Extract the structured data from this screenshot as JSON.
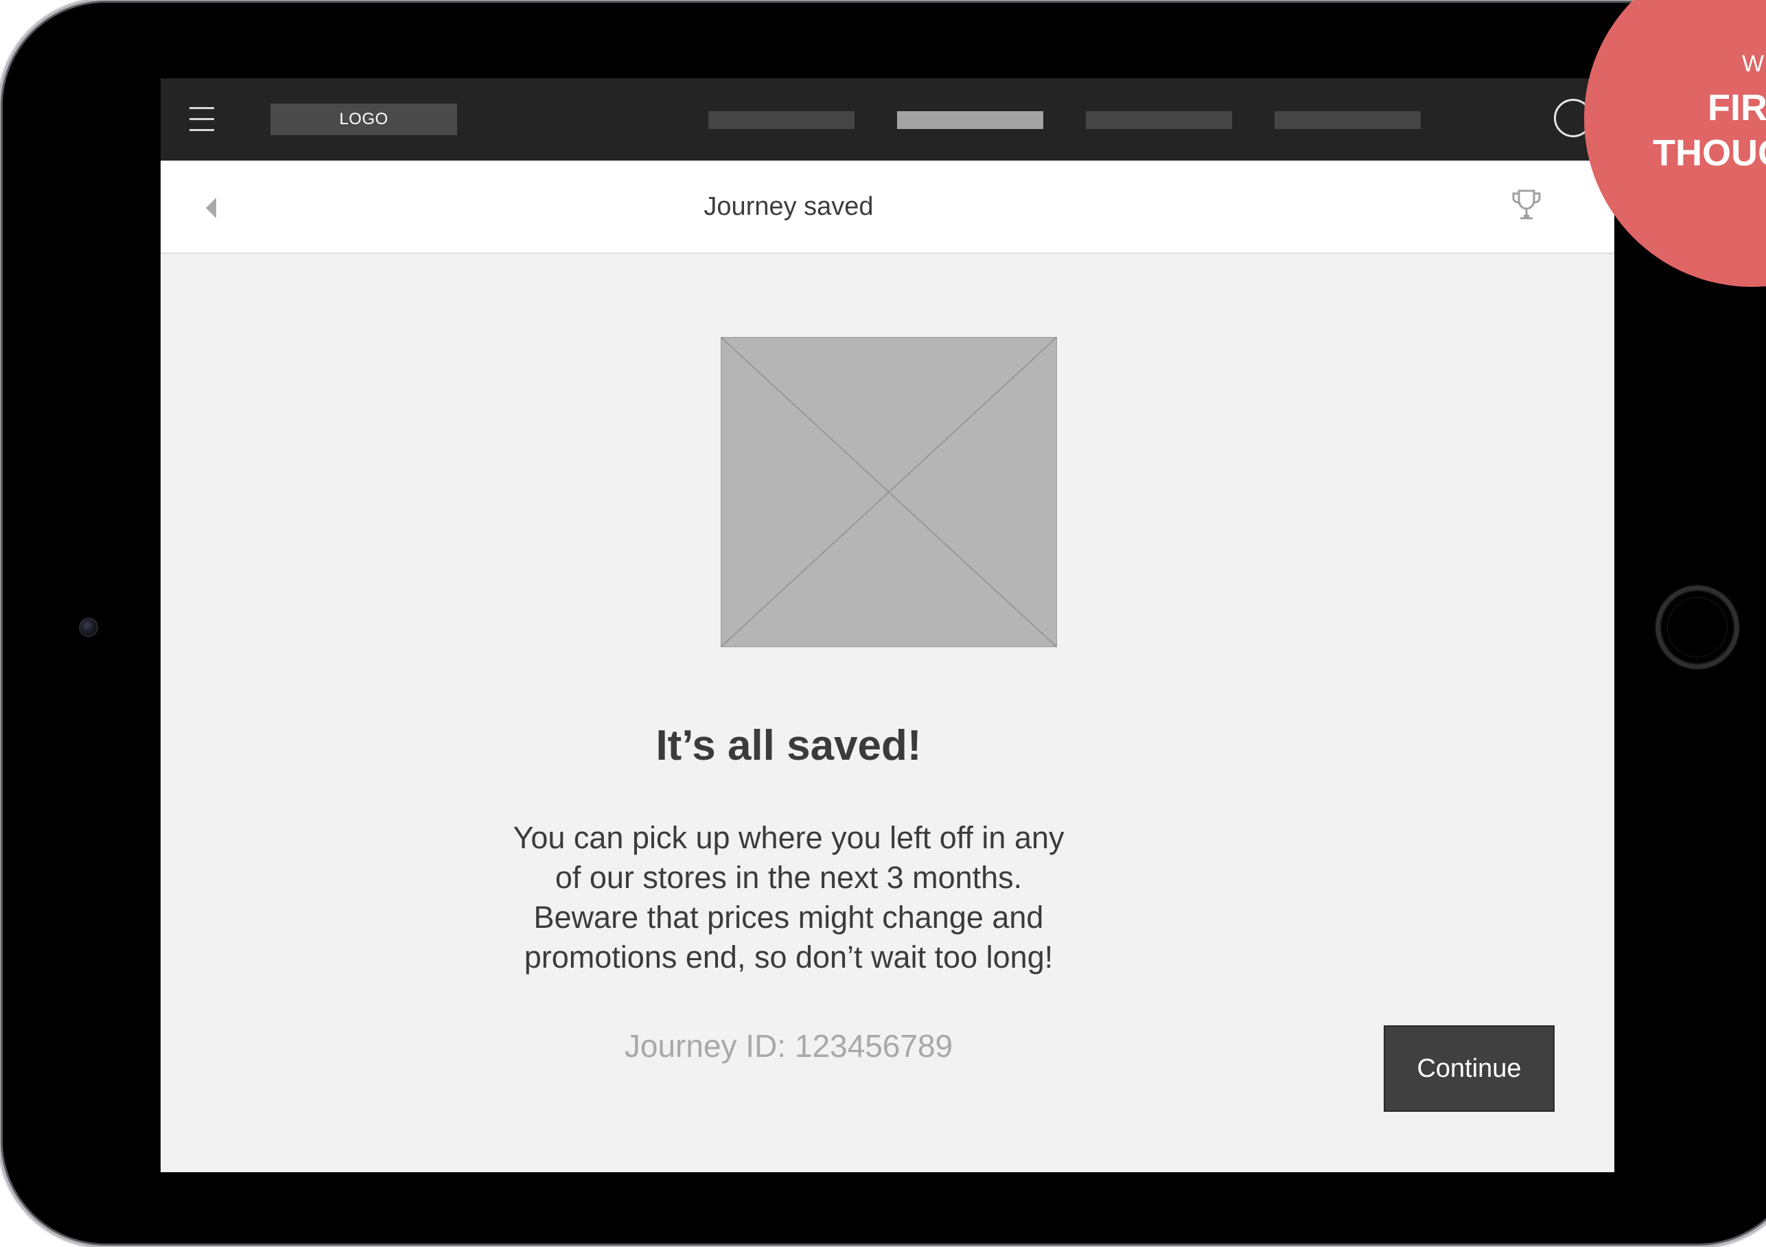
{
  "colors": {
    "device_body": "#000000",
    "topbar": "#242424",
    "screen_background": "#f2f2f2",
    "badge": "#e06565",
    "continue_button": "#404040",
    "muted_text": "#a8a8a8",
    "body_text": "#3b3b3b"
  },
  "topbar": {
    "menu_icon": "hamburger-icon",
    "logo_text": "LOGO",
    "nav_items": [
      {
        "active": false
      },
      {
        "active": true
      },
      {
        "active": false
      },
      {
        "active": false
      }
    ],
    "search_icon": "circle-icon"
  },
  "badge": {
    "line1": "W I",
    "line2": "FIRS",
    "line3": "THOUG"
  },
  "subheader": {
    "back_icon": "triangle-left-icon",
    "title": "Journey saved",
    "trophy_icon": "trophy-icon"
  },
  "content": {
    "image_icon": "image-placeholder-icon",
    "headline": "It’s all saved!",
    "message_lines": [
      "You can pick up where you left off in any",
      "of our stores in the next 3 months.",
      "Beware that prices might change and",
      "promotions end, so don’t wait too long!"
    ],
    "journey_id": "Journey ID: 123456789",
    "continue_label": "Continue"
  }
}
